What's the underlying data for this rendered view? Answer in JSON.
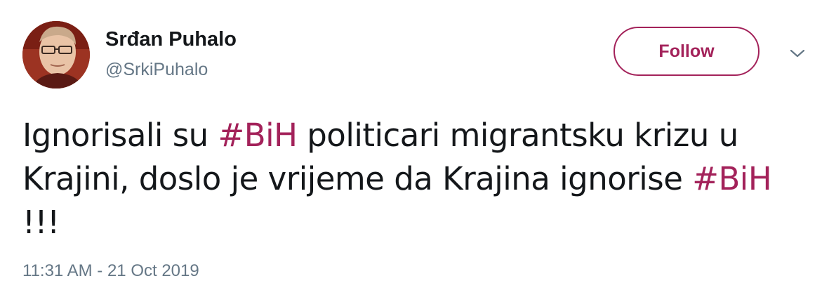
{
  "user": {
    "name": "Srđan Puhalo",
    "handle": "@SrkiPuhalo"
  },
  "follow_label": "Follow",
  "tweet": {
    "segments": [
      {
        "type": "text",
        "value": "Ignorisali su "
      },
      {
        "type": "hashtag",
        "value": "#BiH"
      },
      {
        "type": "text",
        "value": " politicari migrantsku krizu u Krajini, doslo je vrijeme da Krajina ignorise "
      },
      {
        "type": "hashtag",
        "value": "#BiH"
      },
      {
        "type": "text",
        "value": " !!!"
      }
    ]
  },
  "timestamp": "11:31 AM - 21 Oct 2019",
  "icons": {
    "menu": "chevron-down-icon",
    "avatar": "user-avatar"
  },
  "colors": {
    "accent": "#a3225a",
    "text": "#14171a",
    "muted": "#657786"
  }
}
